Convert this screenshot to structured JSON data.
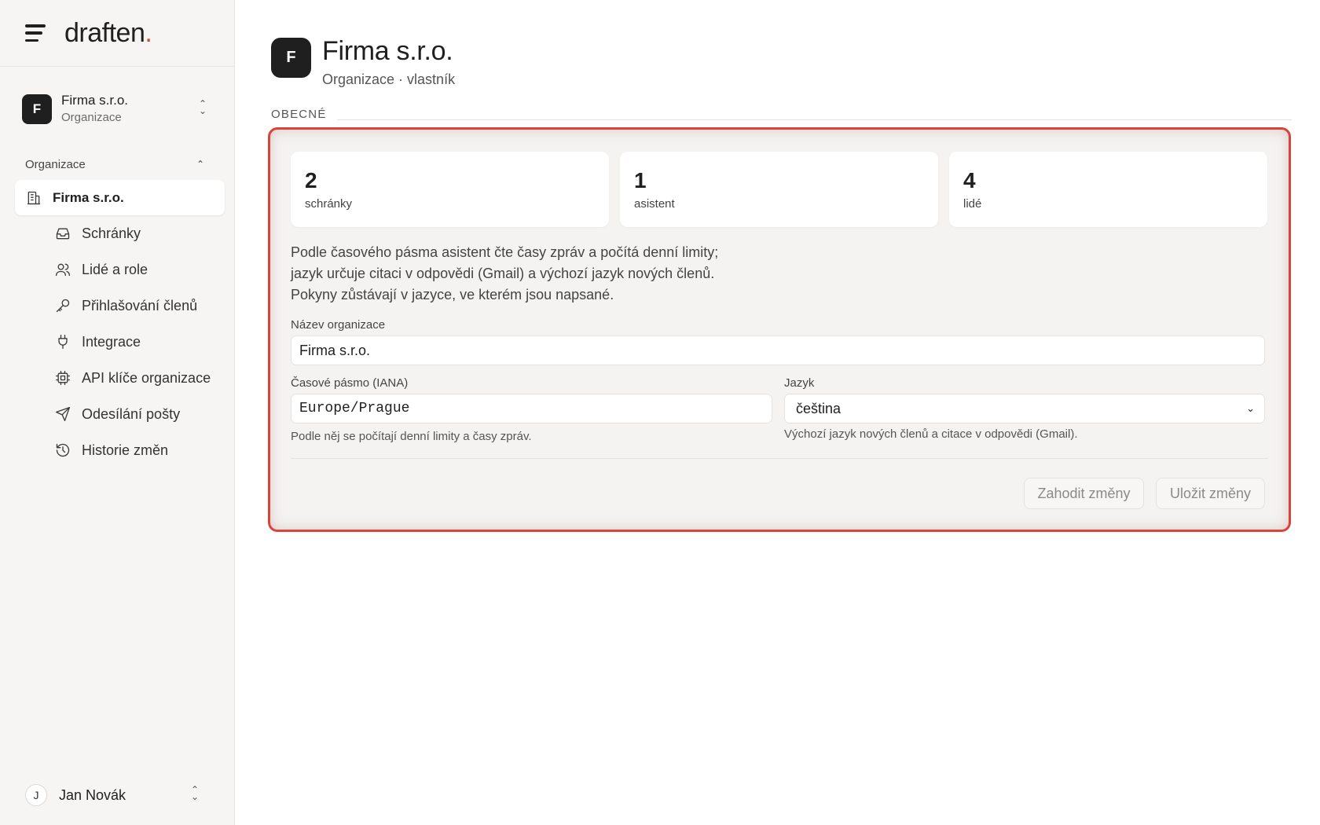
{
  "brand": {
    "name": "draften",
    "dot": "."
  },
  "org_switcher": {
    "avatar": "F",
    "name": "Firma s.r.o.",
    "type": "Organizace"
  },
  "nav": {
    "section_label": "Organizace",
    "active": {
      "label": "Firma s.r.o.",
      "icon": "building-icon"
    },
    "items": [
      {
        "label": "Schránky",
        "icon": "inbox-icon"
      },
      {
        "label": "Lidé a role",
        "icon": "users-icon"
      },
      {
        "label": "Přihlašování členů",
        "icon": "key-icon"
      },
      {
        "label": "Integrace",
        "icon": "plug-icon"
      },
      {
        "label": "API klíče organizace",
        "icon": "chip-icon"
      },
      {
        "label": "Odesílání pošty",
        "icon": "send-icon"
      },
      {
        "label": "Historie změn",
        "icon": "history-icon"
      }
    ]
  },
  "user": {
    "avatar": "J",
    "name": "Jan Novák"
  },
  "header": {
    "avatar": "F",
    "title": "Firma s.r.o.",
    "subtitle": "Organizace · vlastník"
  },
  "section": {
    "label": "OBECNÉ"
  },
  "stats": [
    {
      "value": "2",
      "label": "schránky"
    },
    {
      "value": "1",
      "label": "asistent"
    },
    {
      "value": "4",
      "label": "lidé"
    }
  ],
  "description": [
    "Podle časového pásma asistent čte časy zpráv a počítá denní limity;",
    "jazyk určuje citaci v odpovědi (Gmail) a výchozí jazyk nových členů.",
    "Pokyny zůstávají v jazyce, ve kterém jsou napsané."
  ],
  "form": {
    "org_name": {
      "label": "Název organizace",
      "value": "Firma s.r.o."
    },
    "timezone": {
      "label": "Časové pásmo (IANA)",
      "value": "Europe/Prague",
      "hint": "Podle něj se počítají denní limity a časy zpráv."
    },
    "language": {
      "label": "Jazyk",
      "value": "čeština",
      "hint": "Výchozí jazyk nových členů a citace v odpovědi (Gmail)."
    }
  },
  "actions": {
    "discard": "Zahodit změny",
    "save": "Uložit změny"
  },
  "colors": {
    "accent": "#e0442a",
    "highlight_border": "#d9443a",
    "dark": "#1f1f1f"
  }
}
